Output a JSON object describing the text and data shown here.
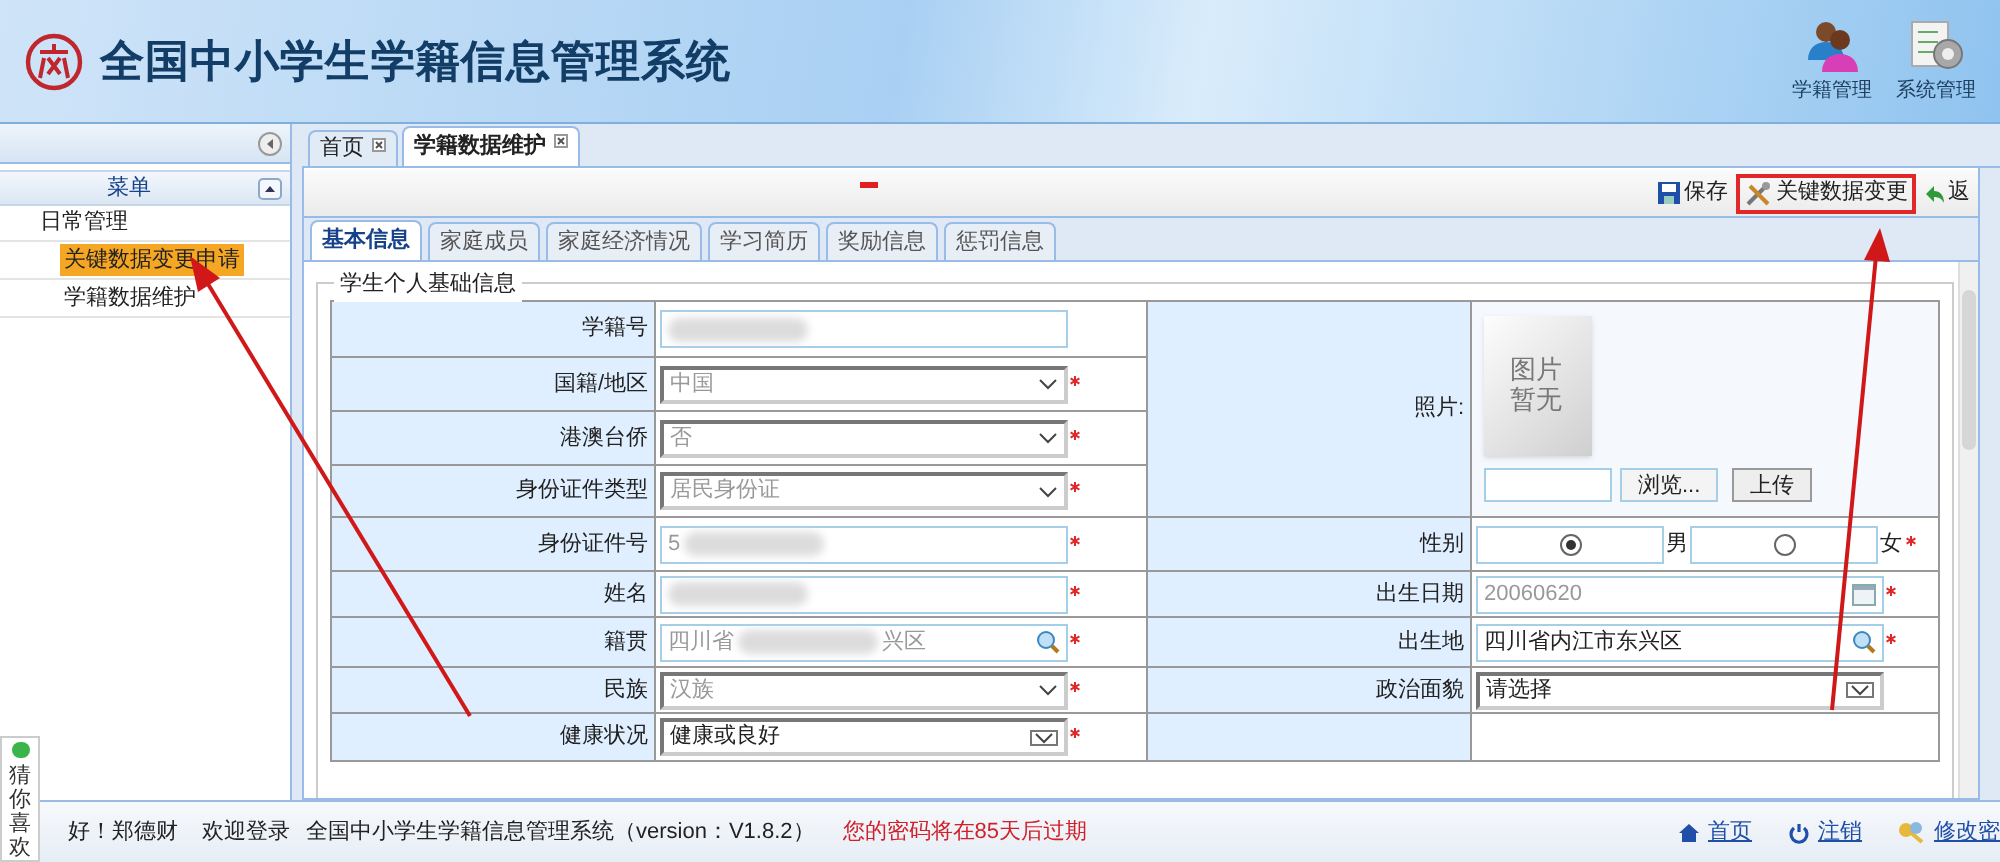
{
  "header": {
    "title": "全国中小学生学籍信息管理系统",
    "modules": [
      {
        "label": "学籍管理",
        "kind": "people"
      },
      {
        "label": "系统管理",
        "kind": "settings"
      }
    ]
  },
  "sidebar": {
    "heading": "菜单",
    "groups": [
      {
        "label": "日常管理",
        "children": [
          {
            "label": "关键数据变更申请",
            "selected": true
          },
          {
            "label": "学籍数据维护",
            "selected": false
          }
        ]
      }
    ]
  },
  "tabs": [
    {
      "label": "首页",
      "selected": false
    },
    {
      "label": "学籍数据维护",
      "selected": true
    }
  ],
  "toolbar": [
    {
      "label": "保存",
      "kind": "save",
      "highlighted": false
    },
    {
      "label": "关键数据变更",
      "kind": "tools",
      "highlighted": true
    },
    {
      "label": "返",
      "kind": "back",
      "highlighted": false
    }
  ],
  "sub_tabs": [
    {
      "label": "基本信息",
      "selected": true
    },
    {
      "label": "家庭成员",
      "selected": false
    },
    {
      "label": "家庭经济情况",
      "selected": false
    },
    {
      "label": "学习简历",
      "selected": false
    },
    {
      "label": "奖励信息",
      "selected": false
    },
    {
      "label": "惩罚信息",
      "selected": false
    }
  ],
  "section": {
    "legend": "学生个人基础信息",
    "left_fields": [
      {
        "label": "学籍号",
        "kind": "text",
        "blurred": true,
        "required": false,
        "disabled": false
      },
      {
        "label": "国籍/地区",
        "kind": "select",
        "value": "中国",
        "required": true,
        "disabled": true
      },
      {
        "label": "港澳台侨",
        "kind": "select",
        "value": "否",
        "required": true,
        "disabled": true
      },
      {
        "label": "身份证件类型",
        "kind": "select",
        "value": "居民身份证",
        "required": true,
        "disabled": true
      },
      {
        "label": "身份证件号",
        "kind": "text",
        "value": "5",
        "blurred": true,
        "required": true,
        "disabled": true
      },
      {
        "label": "姓名",
        "kind": "text",
        "blurred": true,
        "required": true,
        "disabled": false
      },
      {
        "label": "籍贯",
        "kind": "search",
        "value": "四川省",
        "blurred": true,
        "suffix": "兴区",
        "required": true,
        "disabled": true
      },
      {
        "label": "民族",
        "kind": "select",
        "value": "汉族",
        "required": true,
        "disabled": true
      },
      {
        "label": "健康状况",
        "kind": "select",
        "value": "健康或良好",
        "required": true,
        "disabled": false
      }
    ],
    "photo": {
      "label": "照片:",
      "image_text": "图片暂无",
      "browse": "浏览...",
      "upload": "上传"
    },
    "gender": {
      "label": "性别",
      "required": true,
      "options": [
        {
          "label": "男",
          "selected": true
        },
        {
          "label": "女",
          "selected": false
        }
      ]
    },
    "right_fields": [
      {
        "label": "出生日期",
        "kind": "date",
        "value": "20060620",
        "required": true,
        "disabled": true
      },
      {
        "label": "出生地",
        "kind": "search",
        "value": "四川省内江市东兴区",
        "required": true,
        "disabled": false
      },
      {
        "label": "政治面貌",
        "kind": "select",
        "value": "请选择",
        "required": false,
        "disabled": false
      }
    ]
  },
  "status_bar": {
    "greeting": "好！郑德财",
    "welcome": "欢迎登录",
    "system": "全国中小学生学籍信息管理系统（version：V1.8.2）",
    "warning": "您的密码将在85天后过期",
    "links": [
      {
        "label": "首页",
        "kind": "home"
      },
      {
        "label": "注销",
        "kind": "power"
      },
      {
        "label": "修改密",
        "kind": "key"
      }
    ]
  },
  "side_widget": {
    "label": "猜你喜欢"
  }
}
